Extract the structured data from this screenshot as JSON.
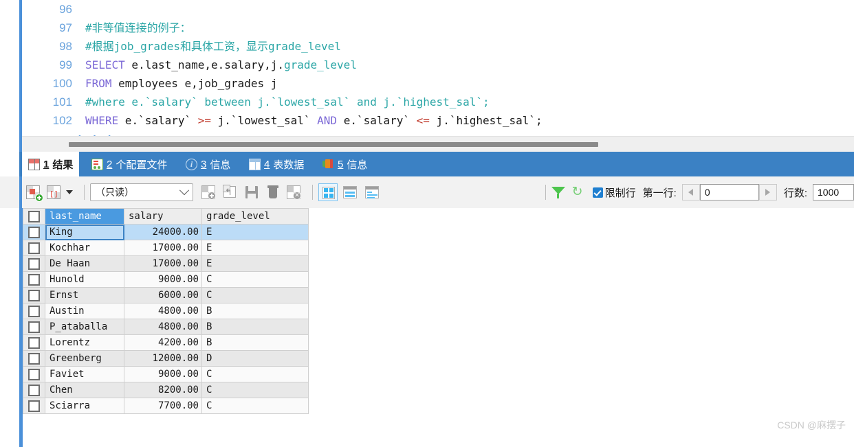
{
  "editor": {
    "lines": [
      {
        "no": "96",
        "segments": []
      },
      {
        "no": "97",
        "segments": [
          {
            "t": "#非等值连接的例子：",
            "c": "cm"
          }
        ]
      },
      {
        "no": "98",
        "segments": [
          {
            "t": "#根据job_grades和具体工资，显示grade_level",
            "c": "cm"
          }
        ]
      },
      {
        "no": "99",
        "segments": [
          {
            "t": "SELECT",
            "c": "kw"
          },
          {
            "t": " e.last_name,e.salary,j.",
            "c": "pl"
          },
          {
            "t": "grade_level",
            "c": "cm"
          }
        ]
      },
      {
        "no": "100",
        "segments": [
          {
            "t": "FROM",
            "c": "kw"
          },
          {
            "t": " employees e,job_grades j",
            "c": "pl"
          }
        ]
      },
      {
        "no": "101",
        "segments": [
          {
            "t": "#where e.`salary` between j.`lowest_sal` and j.`highest_sal`;",
            "c": "cm"
          }
        ]
      },
      {
        "no": "102",
        "segments": [
          {
            "t": "WHERE",
            "c": "kw"
          },
          {
            "t": " e.`salary` ",
            "c": "pl"
          },
          {
            "t": ">=",
            "c": "op"
          },
          {
            "t": " j.`lowest_sal` ",
            "c": "pl"
          },
          {
            "t": "AND",
            "c": "kw"
          },
          {
            "t": " e.`salary` ",
            "c": "pl"
          },
          {
            "t": "<=",
            "c": "op"
          },
          {
            "t": " j.`highest_sal`;",
            "c": "pl"
          }
        ]
      }
    ],
    "continuation": "• • •"
  },
  "tabs": [
    {
      "num": "1",
      "label": "结果",
      "icon": "results-grid-icon",
      "active": true
    },
    {
      "num": "2",
      "label": "个配置文件",
      "icon": "profile-icon",
      "active": false
    },
    {
      "num": "3",
      "label": "信息",
      "icon": "info-circle-icon",
      "active": false
    },
    {
      "num": "4",
      "label": "表数据",
      "icon": "table-grid-icon",
      "active": false
    },
    {
      "num": "5",
      "label": "信息",
      "icon": "status-blocks-icon",
      "active": false
    }
  ],
  "toolbar": {
    "mode_select_value": "（只读）",
    "icons": {
      "add_record": "add-record-icon",
      "record_template": "record-template-icon",
      "dropdown": "chevron-down-icon",
      "insert_record": "insert-record-icon",
      "apply_changes": "apply-changes-icon",
      "save_icon": "save-icon",
      "delete_icon": "trash-icon",
      "discard_icon": "discard-record-icon",
      "view_grid": "grid-view-icon",
      "view_form": "form-view-icon",
      "view_text": "text-view-icon",
      "filter": "filter-funnel-icon",
      "refresh": "refresh-icon"
    },
    "limit_checkbox_label": "限制行",
    "limit_checked": true,
    "first_row_label": "第一行:",
    "first_row_value": "0",
    "row_count_label": "行数:",
    "row_count_value": "1000",
    "prev_arrow": "arrow-left-icon",
    "next_arrow": "arrow-right-icon"
  },
  "results": {
    "columns": [
      "last_name",
      "salary",
      "grade_level"
    ],
    "selected_column": "last_name",
    "selected_row_index": 0,
    "rows": [
      {
        "last_name": "King",
        "salary": "24000.00",
        "grade_level": "E"
      },
      {
        "last_name": "Kochhar",
        "salary": "17000.00",
        "grade_level": "E"
      },
      {
        "last_name": "De Haan",
        "salary": "17000.00",
        "grade_level": "E"
      },
      {
        "last_name": "Hunold",
        "salary": "9000.00",
        "grade_level": "C"
      },
      {
        "last_name": "Ernst",
        "salary": "6000.00",
        "grade_level": "C"
      },
      {
        "last_name": "Austin",
        "salary": "4800.00",
        "grade_level": "B"
      },
      {
        "last_name": "P_ataballa",
        "salary": "4800.00",
        "grade_level": "B"
      },
      {
        "last_name": "Lorentz",
        "salary": "4200.00",
        "grade_level": "B"
      },
      {
        "last_name": "Greenberg",
        "salary": "12000.00",
        "grade_level": "D"
      },
      {
        "last_name": "Faviet",
        "salary": "9000.00",
        "grade_level": "C"
      },
      {
        "last_name": "Chen",
        "salary": "8200.00",
        "grade_level": "C"
      },
      {
        "last_name": "Sciarra",
        "salary": "7700.00",
        "grade_level": "C"
      }
    ]
  },
  "watermark": "CSDN @麻摆子",
  "colors": {
    "tabbar_blue": "#3b81c4",
    "accent_blue": "#4a90d9",
    "header_select_blue": "#4a9ae0",
    "row_select_blue": "#bcdcf7",
    "keyword_purple": "#7b68d6",
    "comment_teal": "#2ba6a6",
    "operator_red": "#c0392b",
    "checkbox_blue": "#1f7fd0",
    "green": "#4ec54e"
  }
}
